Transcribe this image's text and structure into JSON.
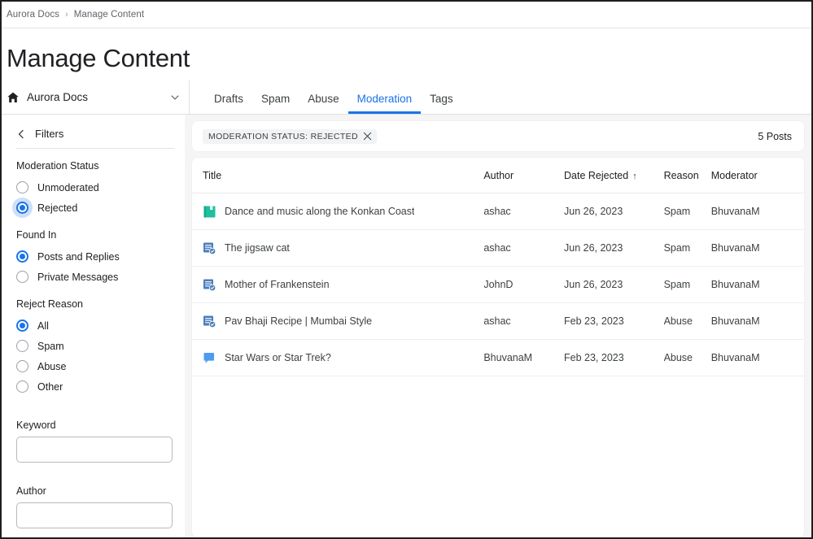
{
  "breadcrumb": {
    "items": [
      "Aurora Docs",
      "Manage Content"
    ],
    "separator": "›"
  },
  "header": {
    "title": "Manage Content"
  },
  "site_selector": {
    "icon": "home-icon",
    "label": "Aurora Docs",
    "chevron": "chevron-down-icon"
  },
  "tabs": [
    {
      "label": "Drafts",
      "active": false
    },
    {
      "label": "Spam",
      "active": false
    },
    {
      "label": "Abuse",
      "active": false
    },
    {
      "label": "Moderation",
      "active": true
    },
    {
      "label": "Tags",
      "active": false
    }
  ],
  "sidebar": {
    "header_label": "Filters",
    "back_icon": "chevron-left-icon",
    "groups": [
      {
        "title": "Moderation Status",
        "options": [
          {
            "label": "Unmoderated",
            "checked": false,
            "focused": false
          },
          {
            "label": "Rejected",
            "checked": true,
            "focused": true
          }
        ]
      },
      {
        "title": "Found In",
        "options": [
          {
            "label": "Posts and Replies",
            "checked": true,
            "focused": false
          },
          {
            "label": "Private Messages",
            "checked": false,
            "focused": false
          }
        ]
      },
      {
        "title": "Reject Reason",
        "options": [
          {
            "label": "All",
            "checked": true,
            "focused": false
          },
          {
            "label": "Spam",
            "checked": false,
            "focused": false
          },
          {
            "label": "Abuse",
            "checked": false,
            "focused": false
          },
          {
            "label": "Other",
            "checked": false,
            "focused": false
          }
        ]
      }
    ],
    "fields": [
      {
        "label": "Keyword",
        "value": "",
        "placeholder": ""
      },
      {
        "label": "Author",
        "value": "",
        "placeholder": ""
      }
    ]
  },
  "main": {
    "filter_chip": {
      "text": "MODERATION STATUS: REJECTED",
      "remove_icon": "close-icon"
    },
    "result_count": "5 Posts",
    "table": {
      "columns": [
        {
          "key": "title",
          "label": "Title",
          "sorted": false
        },
        {
          "key": "author",
          "label": "Author",
          "sorted": false
        },
        {
          "key": "date",
          "label": "Date Rejected",
          "sorted": true,
          "sort_arrow": "↑"
        },
        {
          "key": "reason",
          "label": "Reason",
          "sorted": false
        },
        {
          "key": "moderator",
          "label": "Moderator",
          "sorted": false
        }
      ],
      "rows": [
        {
          "icon": "knowledge-base-article-icon",
          "title": "Dance and music along the Konkan Coast",
          "author": "ashac",
          "date": "Jun 26, 2023",
          "reason": "Spam",
          "moderator": "BhuvanaM"
        },
        {
          "icon": "blog-post-icon",
          "title": "The jigsaw cat",
          "author": "ashac",
          "date": "Jun 26, 2023",
          "reason": "Spam",
          "moderator": "BhuvanaM"
        },
        {
          "icon": "blog-post-icon",
          "title": "Mother of Frankenstein",
          "author": "JohnD",
          "date": "Jun 26, 2023",
          "reason": "Spam",
          "moderator": "BhuvanaM"
        },
        {
          "icon": "blog-post-icon",
          "title": "Pav Bhaji Recipe | Mumbai Style",
          "author": "ashac",
          "date": "Feb 23, 2023",
          "reason": "Abuse",
          "moderator": "BhuvanaM"
        },
        {
          "icon": "discussion-icon",
          "title": "Star Wars or Star Trek?",
          "author": "BhuvanaM",
          "date": "Feb 23, 2023",
          "reason": "Abuse",
          "moderator": "BhuvanaM"
        }
      ]
    }
  },
  "colors": {
    "accent": "#1a73e8",
    "text_primary": "#202124",
    "text_secondary": "#5f6368",
    "page_bg": "#f5f5f5",
    "icon_teal": "#1fbfa0",
    "icon_blue": "#4a7ebb",
    "icon_light_blue": "#4d9cf0"
  }
}
